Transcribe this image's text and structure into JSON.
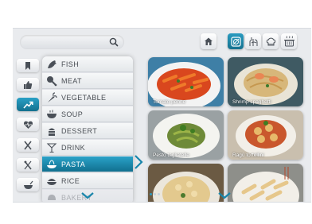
{
  "search": {
    "placeholder": ""
  },
  "top_icons": [
    {
      "name": "home-icon",
      "active": false
    },
    {
      "name": "recipe-book-icon",
      "active": true
    },
    {
      "name": "hand-cooking-icon",
      "active": false
    },
    {
      "name": "chef-hat-icon",
      "active": false
    },
    {
      "name": "cooking-pot-icon",
      "active": false
    }
  ],
  "rail": [
    {
      "name": "bookmark-icon",
      "active": false
    },
    {
      "name": "thumbs-up-icon",
      "active": false
    },
    {
      "name": "trending-icon",
      "active": true
    },
    {
      "name": "heart-monitor-icon",
      "active": false
    },
    {
      "name": "cutlery-icon",
      "active": false
    },
    {
      "name": "utensils-cross-icon",
      "active": false
    },
    {
      "name": "cooking-bowl-icon",
      "active": false
    }
  ],
  "menu": {
    "items": [
      {
        "label": "FISH",
        "icon": "fish-icon"
      },
      {
        "label": "MEAT",
        "icon": "meat-icon"
      },
      {
        "label": "VEGETABLE",
        "icon": "vegetable-icon"
      },
      {
        "label": "SOUP",
        "icon": "soup-icon"
      },
      {
        "label": "DESSERT",
        "icon": "dessert-icon"
      },
      {
        "label": "DRINK",
        "icon": "drink-icon"
      },
      {
        "label": "PASTA",
        "icon": "pasta-icon"
      },
      {
        "label": "RICE",
        "icon": "rice-icon"
      },
      {
        "label": "BAKERY",
        "icon": "bakery-icon"
      }
    ],
    "active_index": 6
  },
  "recipes": [
    {
      "title": "Tomato penne"
    },
    {
      "title": "Shrimp spaghetti"
    },
    {
      "title": "Pesto tagliatelle"
    },
    {
      "title": "Ragù tortellini"
    },
    {
      "title": ""
    },
    {
      "title": ""
    }
  ],
  "colors": {
    "accent": "#1a86ab",
    "background": "#e9ebee"
  }
}
